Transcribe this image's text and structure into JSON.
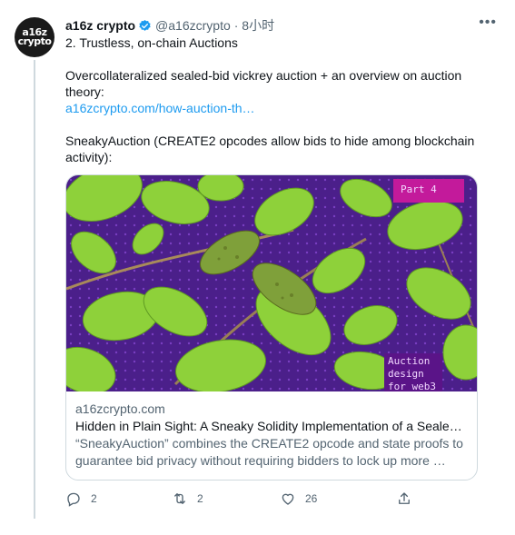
{
  "author": {
    "avatar_line1": "a16z",
    "avatar_line2": "crypto",
    "name": "a16z crypto",
    "handle": "@a16zcrypto",
    "time": "· 8小时"
  },
  "tweet": {
    "line1": "2. Trustless, on-chain Auctions",
    "line2": "Overcollateralized sealed-bid vickrey auction + an overview on auction theory:",
    "link": "a16zcrypto.com/how-auction-th…",
    "line3": "SneakyAuction (CREATE2 opcodes allow bids to hide among blockchain activity):"
  },
  "card": {
    "badge_part": "Part 4",
    "badge_design_1": "Auction",
    "badge_design_2": "design",
    "badge_design_3": "for web3",
    "domain": "a16zcrypto.com",
    "title": "Hidden in Plain Sight: A Sneaky Solidity Implementation of a Sealed-B…",
    "description": "“SneakyAuction” combines the CREATE2 opcode and state proofs to guarantee bid privacy without requiring bidders to lock up more …"
  },
  "actions": {
    "reply_count": "2",
    "retweet_count": "2",
    "like_count": "26"
  },
  "icons": {
    "verified": "verified-badge-icon",
    "more": "more-icon",
    "reply": "reply-icon",
    "retweet": "retweet-icon",
    "like": "heart-icon",
    "share": "share-icon"
  },
  "colors": {
    "accent": "#1d9bf0",
    "muted": "#536471",
    "image_background": "#4b1f8a",
    "leaf": "#8ed13a"
  }
}
